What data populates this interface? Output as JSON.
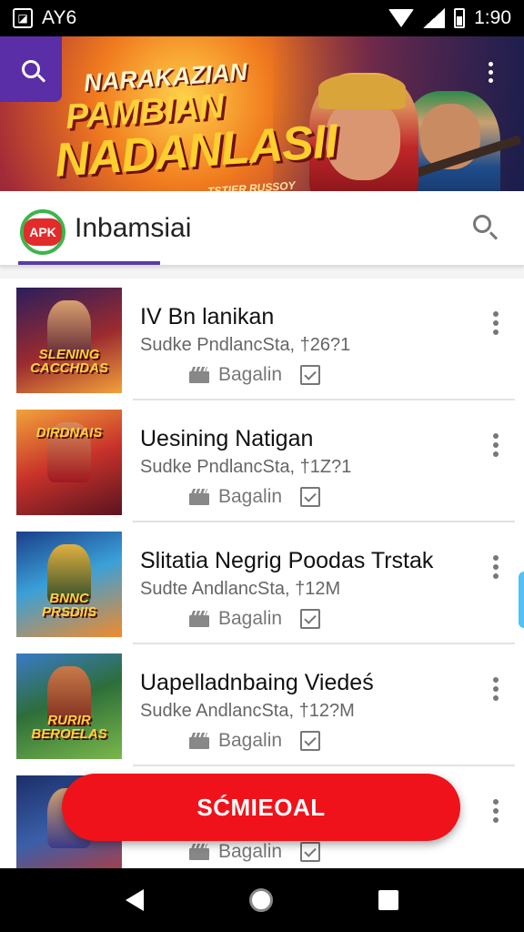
{
  "status_bar": {
    "carrier": "AY6",
    "time": "1:90"
  },
  "banner": {
    "line1": "NARAKAZIAN",
    "line2": "PAMBIAN",
    "line3": "NADANLASII",
    "line4": "TSTIER RUSSOY"
  },
  "app_header": {
    "logo_text": "APK",
    "title": "Inbamsiai"
  },
  "list": {
    "items": [
      {
        "thumb_text": "SLENING CACCHDAS",
        "title": "IV Bn lanikan",
        "subtitle": "Sudke PndlancSta, †26?1",
        "meta_label": "Bagalin",
        "thumb_colors": [
          "#2b1e5c",
          "#9c2b2f",
          "#f2a23a"
        ]
      },
      {
        "thumb_text": "DIRDNAIS",
        "title": "Uesining Natigan",
        "subtitle": "Sudke PndlancSta, †1Z?1",
        "meta_label": "Bagalin",
        "thumb_colors": [
          "#f2a23a",
          "#c8322a",
          "#5a1420"
        ]
      },
      {
        "thumb_text": "BNNC PRSDIIS",
        "title": "Slitatia Negrig Poodas Trstak",
        "subtitle": "Sudte AndlancSta, †12M",
        "meta_label": "Bagalin",
        "thumb_colors": [
          "#1b3f8a",
          "#3aa0d8",
          "#f28a2a"
        ]
      },
      {
        "thumb_text": "RURIR BEROELAS",
        "title": "Uapelladnbaing Viedeś",
        "subtitle": "Sudke AndlancSta, †12?M",
        "meta_label": "Bagalin",
        "thumb_colors": [
          "#2d6e3a",
          "#7ab84a",
          "#c8502a"
        ]
      },
      {
        "thumb_text": "",
        "title": "",
        "subtitle": "",
        "meta_label": "Bagalin",
        "thumb_colors": [
          "#1c2f6a",
          "#3a5fa8",
          "#b83a3a"
        ]
      }
    ]
  },
  "fab": {
    "label": "SĆMIEOAL"
  },
  "colors": {
    "accent_purple": "#5a3ba8",
    "fab_red": "#f0121a",
    "apk_green": "#3cb54a"
  }
}
